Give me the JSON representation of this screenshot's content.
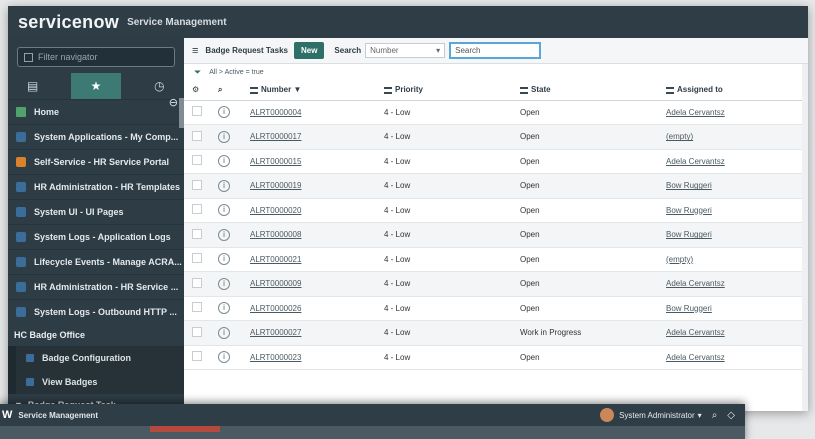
{
  "app": {
    "logo": "servicenow",
    "product": "Service Management"
  },
  "nav": {
    "filter_placeholder": "Filter navigator",
    "tabs": [
      {
        "name": "modules-icon",
        "glyph": "▤"
      },
      {
        "name": "favorites-star-icon",
        "glyph": "★"
      },
      {
        "name": "history-clock-icon",
        "glyph": "◷"
      }
    ],
    "home_label": "Home",
    "favorites": [
      {
        "label": "System Applications - My Comp...",
        "color": "#3a6d9a"
      },
      {
        "label": "Self-Service - HR Service Portal",
        "color": "#d9822b"
      },
      {
        "label": "HR Administration - HR Templates",
        "color": "#3a6d9a"
      },
      {
        "label": "System UI - UI Pages",
        "color": "#3a6d9a"
      },
      {
        "label": "System Logs - Application Logs",
        "color": "#3a6d9a"
      },
      {
        "label": "Lifecycle Events - Manage ACRA...",
        "color": "#3a6d9a"
      },
      {
        "label": "HR Administration - HR Service ...",
        "color": "#3a6d9a"
      },
      {
        "label": "System Logs - Outbound HTTP ...",
        "color": "#3a6d9a"
      }
    ],
    "section_label": "HC Badge Office",
    "sub_items": [
      "Badge Configuration",
      "View Badges"
    ],
    "sub_section_label": "Badge Request Task"
  },
  "list": {
    "title": "Badge Request Tasks",
    "new_label": "New",
    "search_label": "Search",
    "search_field": "Number",
    "search_placeholder": "Search",
    "breadcrumb": "All > Active = true",
    "columns": [
      "Number",
      "Priority",
      "State",
      "Assigned to"
    ],
    "rows": [
      {
        "number": "ALRT0000004",
        "priority": "4 - Low",
        "state": "Open",
        "assigned": "Adela Cervantsz"
      },
      {
        "number": "ALRT0000017",
        "priority": "4 - Low",
        "state": "Open",
        "assigned": "(empty)"
      },
      {
        "number": "ALRT0000015",
        "priority": "4 - Low",
        "state": "Open",
        "assigned": "Adela Cervantsz"
      },
      {
        "number": "ALRT0000019",
        "priority": "4 - Low",
        "state": "Open",
        "assigned": "Bow Ruggeri"
      },
      {
        "number": "ALRT0000020",
        "priority": "4 - Low",
        "state": "Open",
        "assigned": "Bow Ruggeri"
      },
      {
        "number": "ALRT0000008",
        "priority": "4 - Low",
        "state": "Open",
        "assigned": "Bow Ruggeri"
      },
      {
        "number": "ALRT0000021",
        "priority": "4 - Low",
        "state": "Open",
        "assigned": "(empty)"
      },
      {
        "number": "ALRT0000009",
        "priority": "4 - Low",
        "state": "Open",
        "assigned": "Adela Cervantsz"
      },
      {
        "number": "ALRT0000026",
        "priority": "4 - Low",
        "state": "Open",
        "assigned": "Bow Ruggeri"
      },
      {
        "number": "ALRT0000027",
        "priority": "4 - Low",
        "state": "Work in Progress",
        "assigned": "Adela Cervantsz"
      },
      {
        "number": "ALRT0000023",
        "priority": "4 - Low",
        "state": "Open",
        "assigned": "Adela Cervantsz"
      }
    ]
  },
  "front": {
    "brand": "W",
    "product": "Service Management",
    "user": "System Administrator",
    "caret": "▾",
    "search_glyph": "⌕",
    "chat_glyph": "◇"
  },
  "colors": {
    "header": "#2f3d46",
    "nav": "#2e3c45",
    "accent": "#2e6f68",
    "favorite_tab": "#3c7a73"
  }
}
